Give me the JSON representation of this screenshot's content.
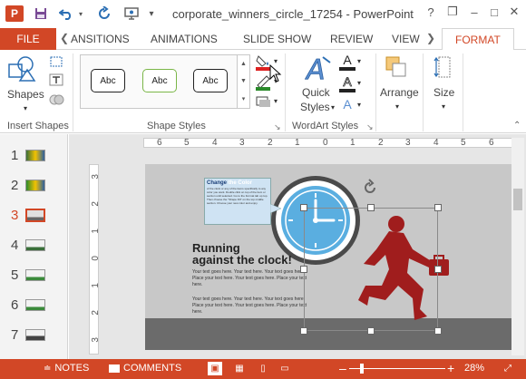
{
  "app": {
    "logo_text": "P",
    "title": "corporate_winners_circle_17254 - PowerPoint",
    "accent_color": "#d24726"
  },
  "qat": [
    "save-icon",
    "undo-icon",
    "redo-icon",
    "present-icon",
    "customize-icon"
  ],
  "window": {
    "help": "?",
    "restore": "❐",
    "minimize": "–",
    "maximize": "□",
    "close": "✕"
  },
  "tabs": {
    "file": "FILE",
    "items": [
      "ANSITIONS",
      "ANIMATIONS",
      "SLIDE SHOW",
      "REVIEW",
      "VIEW"
    ],
    "active": "FORMAT"
  },
  "ribbon": {
    "insert_shapes": {
      "shapes_label": "Shapes",
      "group_label": "Insert Shapes"
    },
    "shape_styles": {
      "samples": [
        "Abc",
        "Abc",
        "Abc"
      ],
      "group_label": "Shape Styles"
    },
    "wordart": {
      "quick_styles_label": "Quick",
      "quick_styles_label2": "Styles",
      "group_label": "WordArt Styles",
      "letter": "A"
    },
    "arrange_label": "Arrange",
    "size_label": "Size"
  },
  "slides": [
    {
      "number": "1"
    },
    {
      "number": "2"
    },
    {
      "number": "3",
      "selected": true
    },
    {
      "number": "4"
    },
    {
      "number": "5"
    },
    {
      "number": "6"
    },
    {
      "number": "7"
    }
  ],
  "rulers": {
    "horizontal": [
      "6",
      "5",
      "4",
      "3",
      "2",
      "1",
      "0",
      "1",
      "2",
      "3",
      "4",
      "5",
      "6"
    ],
    "vertical": [
      "3",
      "2",
      "1",
      "0",
      "1",
      "2",
      "3"
    ]
  },
  "slide": {
    "callout_title_a": "Change",
    "callout_title_b": "the Color",
    "callout_body": "of the clock or any of the items specifically to any color you want. Double click on top of the item or section until selected. Go to the Format tab up top. Then choose the \"Shape Fill\" on the top middle section. Choose your new color and enjoy.",
    "title_line1": "Running",
    "title_line2": "against the clock!",
    "body1": "Your text goes here. Your text here. Your text goes here. Place your text here. Your text goes here. Place your text here.",
    "body2": "Your text goes here. Your text here. Your text goes here. Place your text here. Your text goes here. Place your text here."
  },
  "status": {
    "notes": "NOTES",
    "comments": "COMMENTS",
    "zoom_minus": "–",
    "zoom_plus": "+",
    "zoom_level": "28%"
  }
}
